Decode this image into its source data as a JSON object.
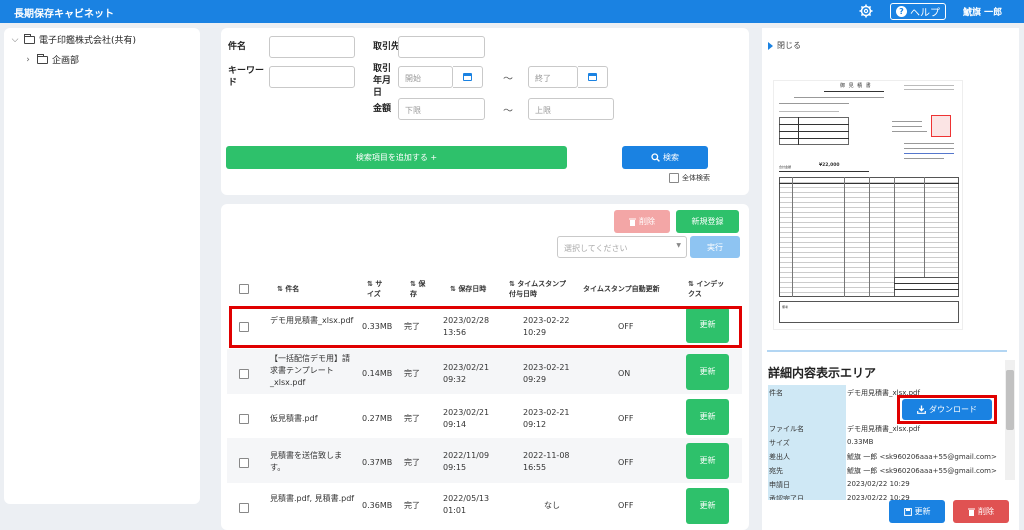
{
  "header": {
    "app_title": "長期保存キャビネット",
    "help_label": "ヘルプ",
    "user_name": "鯱旗 一郎"
  },
  "sidebar": {
    "root_label": "電子印鑑株式会社(共有)",
    "child_label": "企画部"
  },
  "search": {
    "name_label": "件名",
    "keyword_label": "キーワード",
    "client_label": "取引先",
    "date_label": "取引年月日",
    "date_start_placeholder": "開始",
    "date_end_placeholder": "終了",
    "amount_label": "金額",
    "amount_min_placeholder": "下限",
    "amount_max_placeholder": "上限",
    "range_sep": "〜",
    "add_criteria_label": "検索項目を追加する +",
    "search_button_label": "検索",
    "full_search_label": "全体検索"
  },
  "actions": {
    "delete_label": "削除",
    "new_label": "新規登録",
    "select_placeholder": "選択してください",
    "execute_label": "実行"
  },
  "table": {
    "headers": [
      "件名",
      "サイズ",
      "保存",
      "保存日時",
      "タイムスタンプ付与日時",
      "タイムスタンプ自動更新",
      "インデックス"
    ],
    "rows": [
      {
        "name": "デモ用見積書_xlsx.pdf",
        "size": "0.33MB",
        "status": "完了",
        "saved": "2023/02/28 13:56",
        "stamped": "2023-02-22 10:29",
        "auto": "OFF",
        "action": "更新"
      },
      {
        "name": "【一括配信デモ用】請求書テンプレート_xlsx.pdf",
        "size": "0.14MB",
        "status": "完了",
        "saved": "2023/02/21 09:32",
        "stamped": "2023-02-21 09:29",
        "auto": "ON",
        "action": "更新"
      },
      {
        "name": "仮見積書.pdf",
        "size": "0.27MB",
        "status": "完了",
        "saved": "2023/02/21 09:14",
        "stamped": "2023-02-21 09:12",
        "auto": "OFF",
        "action": "更新"
      },
      {
        "name": "見積書を送信致します。",
        "size": "0.37MB",
        "status": "完了",
        "saved": "2022/11/09 09:15",
        "stamped": "2022-11-08 16:55",
        "auto": "OFF",
        "action": "更新"
      },
      {
        "name": "見積書.pdf, 見積書.pdf",
        "size": "0.36MB",
        "status": "完了",
        "saved": "2022/05/13 01:01",
        "stamped": "なし",
        "auto": "OFF",
        "action": "更新"
      }
    ]
  },
  "preview": {
    "close_label": "閉じる",
    "doc_title": "御 見 積 書",
    "total_label": "合計金額",
    "total_value": "¥22,000",
    "note_label": "備考"
  },
  "detail": {
    "title": "詳細内容表示エリア",
    "subject_key": "件名",
    "subject_val": "デモ用見積書_xlsx.pdf",
    "download_label": "ダウンロード",
    "items": [
      {
        "key": "ファイル名",
        "val": "デモ用見積書_xlsx.pdf"
      },
      {
        "key": "サイズ",
        "val": "0.33MB"
      },
      {
        "key": "差出人",
        "val": "鯱旗 一郎 <sk960206aaa+55@gmail.com>"
      },
      {
        "key": "宛先",
        "val": "鯱旗 一郎 <sk960206aaa+55@gmail.com>"
      },
      {
        "key": "申請日",
        "val": "2023/02/22 10:29"
      },
      {
        "key": "承認完了日",
        "val": "2023/02/22 10:29"
      }
    ],
    "update_label": "更新",
    "delete_label": "削除"
  },
  "colors": {
    "primary": "#1a82e2",
    "success": "#2ec16b",
    "danger": "#e05252",
    "highlight": "#e00000"
  }
}
